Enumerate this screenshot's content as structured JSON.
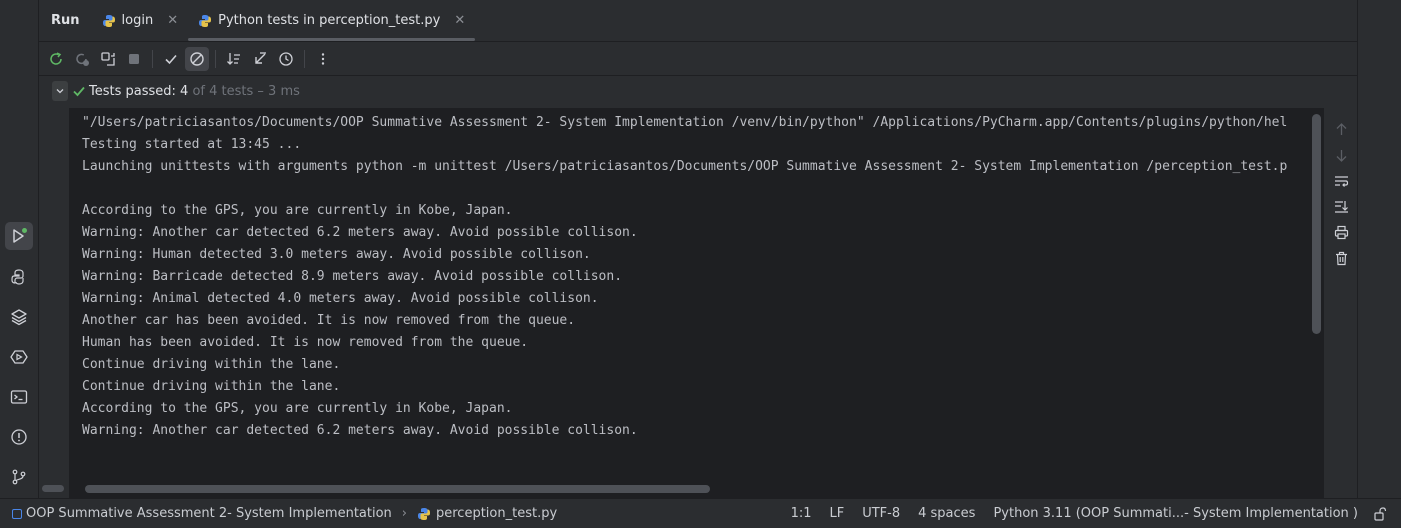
{
  "run_panel": {
    "title": "Run",
    "tabs": [
      {
        "label": "login",
        "icon": "python-icon",
        "close": "✕"
      },
      {
        "label": "Python tests in perception_test.py",
        "icon": "python-tests-icon",
        "close": "✕",
        "selected": true
      }
    ]
  },
  "toolbar": {
    "buttons": [
      "rerun-icon",
      "rerun-failed-icon",
      "toggle-auto-test-icon",
      "stop-icon",
      "show-passed-icon",
      "show-ignored-icon",
      "sort-alphabetically-icon",
      "sort-by-duration-icon",
      "history-icon",
      "more-options-icon"
    ]
  },
  "test_status": {
    "label": "Tests passed: ",
    "count": "4",
    "detail": "of 4 tests – 3 ms"
  },
  "console": {
    "lines": [
      "\"/Users/patriciasantos/Documents/OOP Summative Assessment 2- System Implementation /venv/bin/python\" /Applications/PyCharm.app/Contents/plugins/python/hel",
      "Testing started at 13:45 ...",
      "Launching unittests with arguments python -m unittest /Users/patriciasantos/Documents/OOP Summative Assessment 2- System Implementation /perception_test.p",
      "",
      "According to the GPS, you are currently in Kobe, Japan.",
      "Warning: Another car detected 6.2 meters away. Avoid possible collison.",
      "Warning: Human detected 3.0 meters away. Avoid possible collison.",
      "Warning: Barricade detected 8.9 meters away. Avoid possible collison.",
      "Warning: Animal detected 4.0 meters away. Avoid possible collison.",
      "Another car has been avoided. It is now removed from the queue.",
      "Human has been avoided. It is now removed from the queue.",
      "Continue driving within the lane.",
      "Continue driving within the lane.",
      "According to the GPS, you are currently in Kobe, Japan.",
      "Warning: Another car detected 6.2 meters away. Avoid possible collison."
    ]
  },
  "statusbar": {
    "project": "OOP Summative Assessment 2- System Implementation",
    "file": "perception_test.py",
    "position": "1:1",
    "line_separator": "LF",
    "encoding": "UTF-8",
    "indent": "4 spaces",
    "interpreter": "Python 3.11 (OOP Summati...- System Implementation )"
  },
  "colors": {
    "background": "#2b2d30",
    "console_background": "#1e1f22",
    "success_green": "#5fb865",
    "accent_blue": "#4a86e8"
  }
}
